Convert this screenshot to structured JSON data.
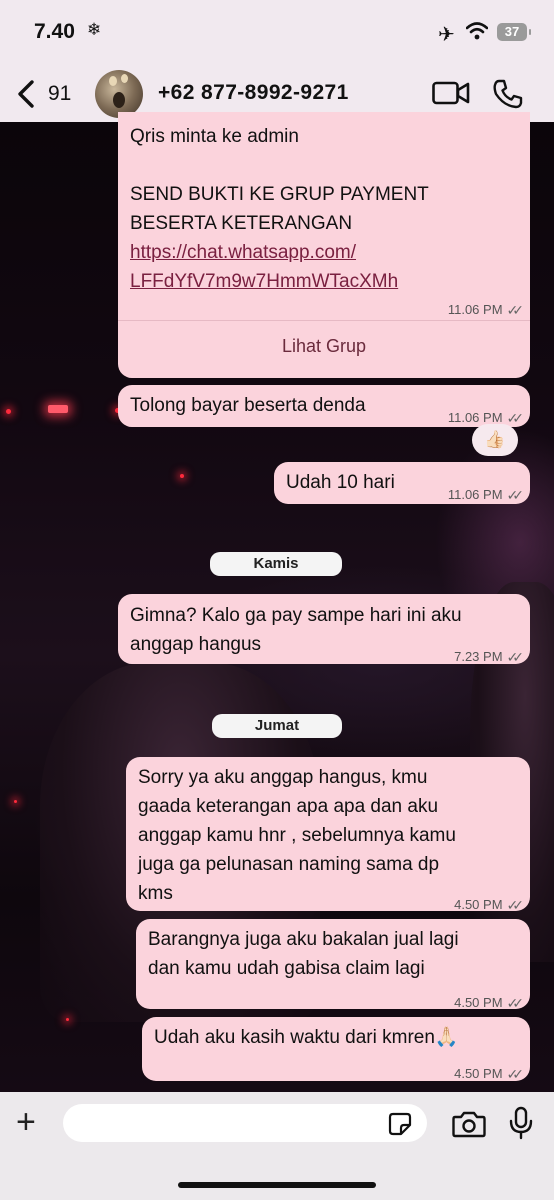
{
  "status_bar": {
    "time": "7.40",
    "snow_glyph": "❄",
    "airplane_glyph": "✈",
    "battery": "37"
  },
  "header": {
    "back_count": "91",
    "title": "+62 877-8992-9271"
  },
  "messages": [
    {
      "lines": [
        "Qris minta ke admin",
        "",
        "SEND BUKTI KE GRUP PAYMENT",
        "BESERTA KETERANGAN"
      ],
      "link_lines": [
        "https://chat.whatsapp.com/",
        "LFFdYfV7m9w7HmmWTacXMh"
      ],
      "time": "11.06 PM",
      "action": "Lihat Grup"
    },
    {
      "text": "Tolong bayar beserta denda",
      "time": "11.06 PM",
      "reaction": "👍🏻"
    },
    {
      "text": "Udah 10 hari",
      "time": "11.06 PM"
    },
    {
      "text": "Gimna? Kalo ga pay sampe hari ini aku anggap hangus",
      "lines": [
        "Gimna? Kalo ga pay sampe hari ini aku",
        "anggap hangus"
      ],
      "time": "7.23 PM"
    },
    {
      "lines": [
        "Sorry ya aku anggap hangus, kmu",
        "gaada keterangan apa apa dan aku",
        "anggap kamu hnr , sebelumnya kamu",
        "juga ga pelunasan naming sama dp",
        "kms"
      ],
      "time": "4.50 PM"
    },
    {
      "lines": [
        "Barangnya juga aku bakalan jual lagi",
        "dan kamu udah gabisa claim lagi"
      ],
      "time": "4.50 PM"
    },
    {
      "text": "Udah aku kasih waktu dari kmren🙏🏻",
      "time": "4.50 PM"
    }
  ],
  "day_labels": {
    "kamis": "Kamis",
    "jumat": "Jumat"
  },
  "ticks": "✓✓",
  "composer": {
    "plus": "+",
    "value": ""
  },
  "colors": {
    "bubble": "#fbd3dc",
    "header_bg": "#f1e9ef",
    "link": "#7a2040"
  },
  "icons": [
    "chevron-left-icon",
    "video-call-icon",
    "phone-icon",
    "plus-icon",
    "sticker-icon",
    "camera-icon",
    "microphone-icon",
    "wifi-icon",
    "airplane-icon",
    "battery-icon"
  ]
}
